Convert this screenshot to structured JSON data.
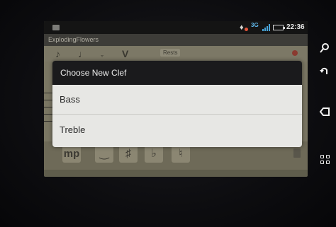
{
  "status_bar": {
    "time": "22:36",
    "icons": [
      "notification-icon",
      "network-icon",
      "signal-icon",
      "battery-icon"
    ]
  },
  "app": {
    "title": "ExplodingFlowers"
  },
  "toolbar": {
    "rests_label": "Rests"
  },
  "palette": {
    "dynamic_label": "mp",
    "sharp_label": "♯",
    "flat_label": "♭",
    "natural_label": "♮"
  },
  "dialog": {
    "title": "Choose New Clef",
    "options": [
      {
        "label": "Bass"
      },
      {
        "label": "Treble"
      }
    ]
  },
  "hardware_buttons": [
    "search-icon",
    "back-icon",
    "backspace-icon",
    "menu-icon"
  ],
  "colors": {
    "dialog_header": "#1a1a1c",
    "dialog_body": "#e7e7e4",
    "screen_dim": "#5f5d4c"
  }
}
